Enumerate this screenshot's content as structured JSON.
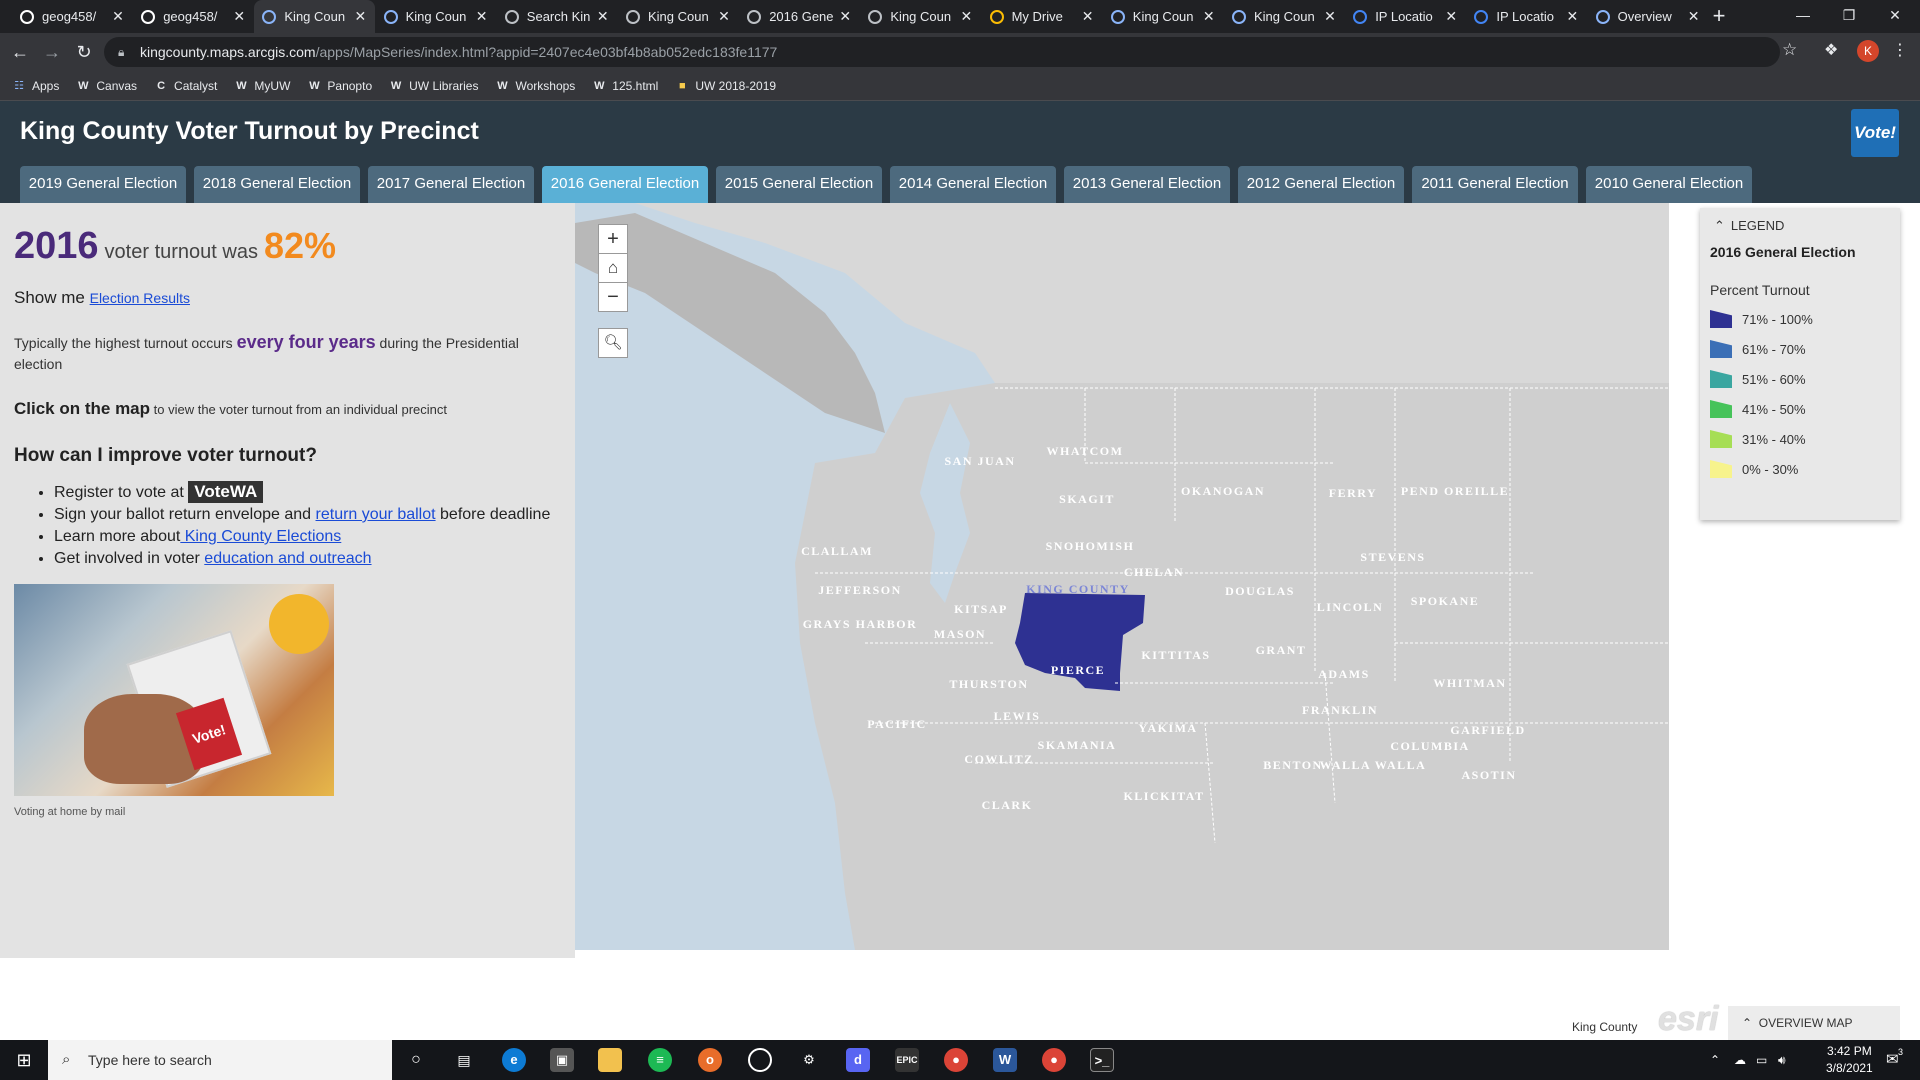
{
  "browser": {
    "tabs": [
      {
        "title": "geog458/",
        "icon": "github-icon",
        "active": false
      },
      {
        "title": "geog458/",
        "icon": "github-icon",
        "active": false
      },
      {
        "title": "King Coun",
        "icon": "globe-icon",
        "active": true
      },
      {
        "title": "King Coun",
        "icon": "globe-icon",
        "active": false
      },
      {
        "title": "Search Kin",
        "icon": "page-icon",
        "active": false
      },
      {
        "title": "King Coun",
        "icon": "page-icon",
        "active": false
      },
      {
        "title": "2016 Gene",
        "icon": "page-icon",
        "active": false
      },
      {
        "title": "King Coun",
        "icon": "page-icon",
        "active": false
      },
      {
        "title": "My Drive",
        "icon": "drive-icon",
        "active": false
      },
      {
        "title": "King Coun",
        "icon": "globe-icon",
        "active": false
      },
      {
        "title": "King Coun",
        "icon": "globe-icon",
        "active": false
      },
      {
        "title": "IP Locatio",
        "icon": "ip-icon",
        "active": false
      },
      {
        "title": "IP Locatio",
        "icon": "ip-icon",
        "active": false
      },
      {
        "title": "Overview",
        "icon": "globe-icon",
        "active": false
      }
    ],
    "url_host": "kingcounty.maps.arcgis.com",
    "url_path": "/apps/MapSeries/index.html?appid=2407ec4e03bf4b8ab052edc183fe1177",
    "avatar_letter": "K",
    "bookmarks": [
      {
        "label": "Apps",
        "icon": "apps-grid-icon"
      },
      {
        "label": "Canvas",
        "icon": "W"
      },
      {
        "label": "Catalyst",
        "icon": "C"
      },
      {
        "label": "MyUW",
        "icon": "W"
      },
      {
        "label": "Panopto",
        "icon": "W"
      },
      {
        "label": "UW Libraries",
        "icon": "W"
      },
      {
        "label": "Workshops",
        "icon": "W"
      },
      {
        "label": "125.html",
        "icon": "W"
      },
      {
        "label": "UW 2018-2019",
        "icon": "folder-icon"
      }
    ]
  },
  "app": {
    "title": "King County Voter Turnout by Precinct",
    "logo_text": "Vote!",
    "tabs": [
      "2019 General Election",
      "2018 General Election",
      "2017 General Election",
      "2016 General Election",
      "2015 General Election",
      "2014 General Election",
      "2013 General Election",
      "2012 General Election",
      "2011 General Election",
      "2010 General Election"
    ],
    "active_tab_index": 3
  },
  "panel": {
    "year": "2016",
    "turnout_mid": "voter turnout was",
    "turnout_pct": "82%",
    "show_me": "Show me",
    "show_me_link": "Election Results",
    "para_pre": "Typically the highest turnout occurs ",
    "para_emph": "every four years",
    "para_post": " during the Presidential election",
    "click_bold": "Click on the map",
    "click_rest": " to view the voter turnout from an individual precinct",
    "how_heading": "How can I improve voter turnout?",
    "bullet1_pre": "Register to vote at ",
    "bullet1_badge": "VoteWA",
    "bullet2_pre": "Sign your ballot return envelope and ",
    "bullet2_link": "return your ballot",
    "bullet2_post": " before deadline",
    "bullet3_pre": "Learn more about",
    "bullet3_link": " King County Elections",
    "bullet4_pre": "Get involved in voter ",
    "bullet4_link": "education and outreach",
    "photo_sticker": "Vote!",
    "caption": "Voting at home by mail"
  },
  "map": {
    "counties": [
      "SAN JUAN",
      "WHATCOM",
      "SKAGIT",
      "OKANOGAN",
      "FERRY",
      "PEND OREILLE",
      "CLALLAM",
      "SNOHOMISH",
      "STEVENS",
      "CHELAN",
      "JEFFERSON",
      "KING COUNTY",
      "DOUGLAS",
      "LINCOLN",
      "SPOKANE",
      "KITSAP",
      "GRAYS HARBOR",
      "MASON",
      "KITTITAS",
      "GRANT",
      "PIERCE",
      "ADAMS",
      "THURSTON",
      "WHITMAN",
      "LEWIS",
      "FRANKLIN",
      "PACIFIC",
      "YAKIMA",
      "GARFIELD",
      "SKAMANIA",
      "COLUMBIA",
      "COWLITZ",
      "BENTON",
      "WALLA WALLA",
      "ASOTIN",
      "KLICKITAT",
      "CLARK"
    ],
    "attribution": "King County",
    "esri": "esri",
    "overview_label": "OVERVIEW MAP",
    "colors": {
      "water": "#c7d7e4",
      "land": "#cfcfcf",
      "king": "#2e3192"
    }
  },
  "legend": {
    "header": "LEGEND",
    "subtitle": "2016 General Election",
    "field": "Percent Turnout",
    "classes": [
      {
        "label": "71% - 100%",
        "color": "#2e3192"
      },
      {
        "label": "61% - 70%",
        "color": "#3b6fb6"
      },
      {
        "label": "51% - 60%",
        "color": "#3aa6a0"
      },
      {
        "label": "41% - 50%",
        "color": "#46c35a"
      },
      {
        "label": "31% - 40%",
        "color": "#a6de55"
      },
      {
        "label": "0% - 30%",
        "color": "#f7f38c"
      }
    ]
  },
  "taskbar": {
    "search_placeholder": "Type here to search",
    "time": "3:42 PM",
    "date": "3/8/2021",
    "notif_count": "3"
  }
}
